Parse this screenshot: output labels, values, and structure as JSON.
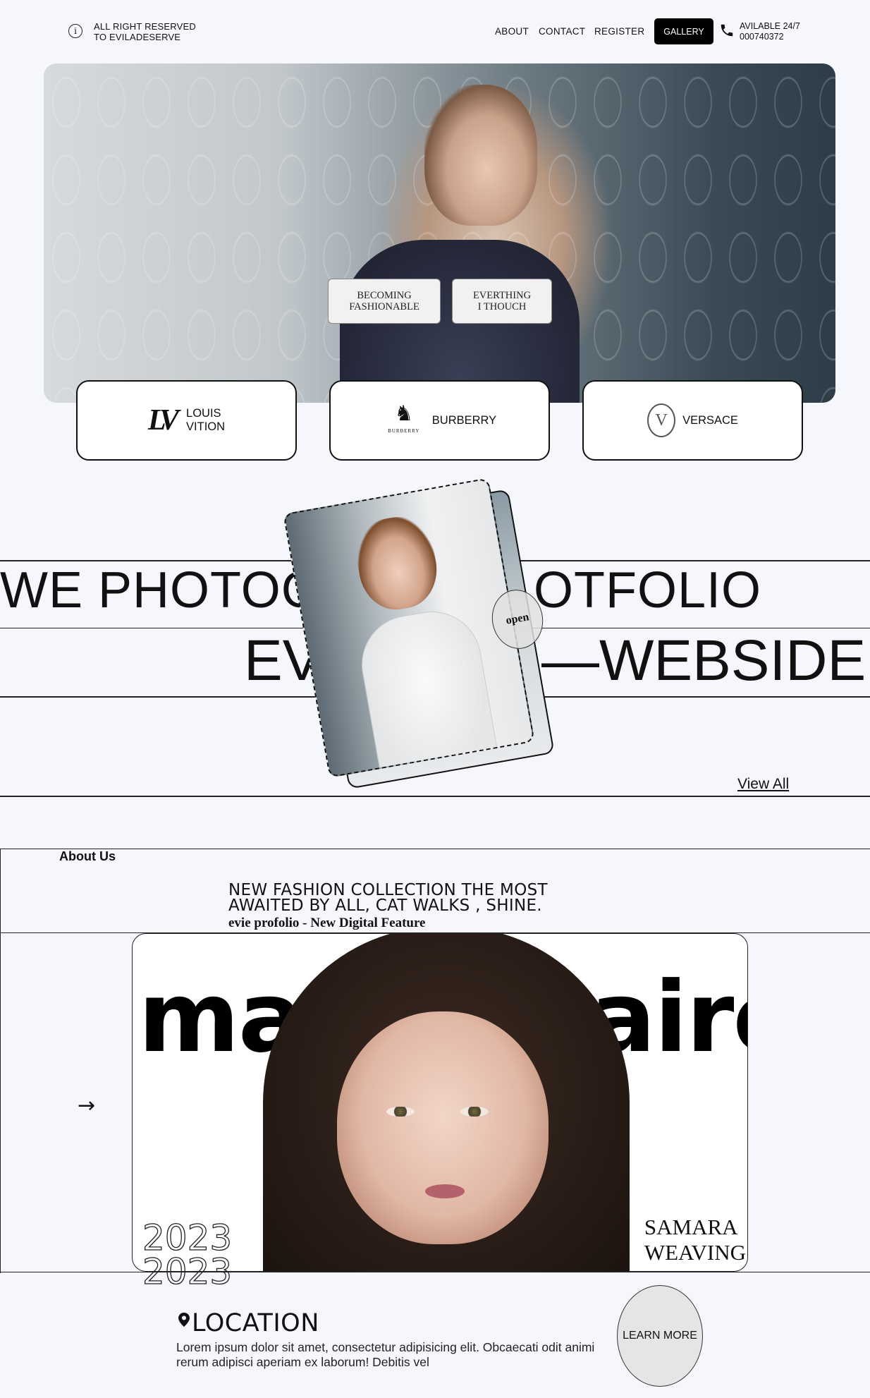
{
  "header": {
    "copyright_line1": "ALL RIGHT RESERVED",
    "copyright_line2": "TO EVILADESERVE",
    "nav": [
      "ABOUT",
      "CONTACT",
      "REGISTER"
    ],
    "gallery_label": "GALLERY",
    "availability_line1": "AVILABLE 24/7",
    "availability_line2": "000740372"
  },
  "hero": {
    "button1_line1": "BECOMING",
    "button1_line2": "FASHIONABLE",
    "button2_line1": "EVERTHING",
    "button2_line2": "I THOUCH"
  },
  "brands": [
    {
      "logo": "LV",
      "line1": "LOUIS",
      "line2": "VITION"
    },
    {
      "logo": "BURBERRY",
      "line1": "BURBERRY",
      "line2": ""
    },
    {
      "logo": "V",
      "line1": "VERSACE",
      "line2": ""
    }
  ],
  "marquee": {
    "line1_left": "WE PHOTOG",
    "line1_right": "OTFOLIO",
    "line2_left": "EV",
    "line2_right": "—WEBSIDE",
    "open_label": "open",
    "view_all": "View All"
  },
  "about": {
    "label": "About Us",
    "title_line1": "NEW FASHION COLLECTION THE MOST",
    "title_line2": "AWAITED BY ALL, CAT WALKS , SHINE.",
    "subtitle": "evie profolio - New Digital Feature",
    "magazine_left": "ma",
    "magazine_right": "aire",
    "model_first": "SAMARA",
    "model_last": "WEAVING",
    "year": "2023",
    "arrow": "→"
  },
  "location": {
    "title": "LOCATION",
    "text": "Lorem ipsum dolor sit amet, consectetur adipisicing elit. Obcaecati odit animi rerum adipisci aperiam ex laborum! Debitis vel",
    "learn_more": "LEARN MORE"
  }
}
